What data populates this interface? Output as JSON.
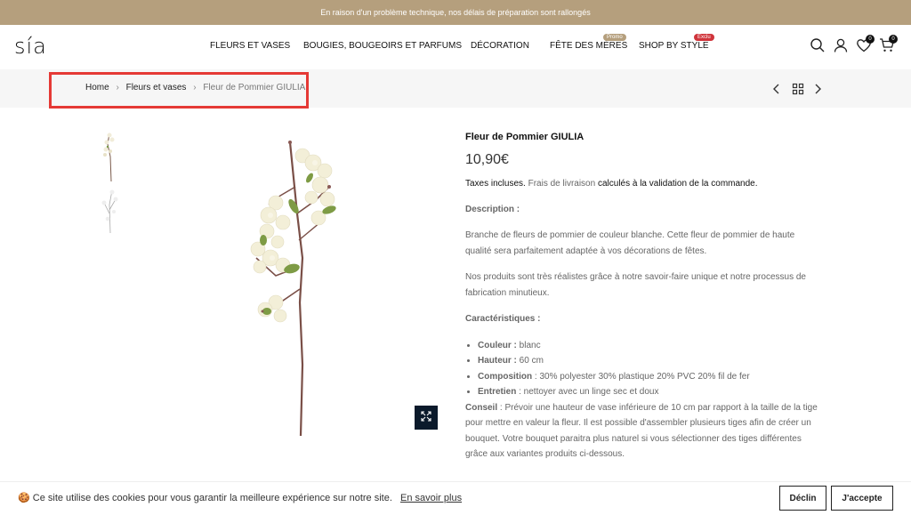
{
  "announcement": "En raison d'un problème technique, nos délais de préparation sont rallongés",
  "header": {
    "logo": "sía",
    "nav": [
      {
        "label": "FLEURS ET VASES"
      },
      {
        "label": "BOUGIES, BOUGEOIRS ET PARFUMS"
      },
      {
        "label": "DÉCORATION"
      },
      {
        "label": "FÊTE DES MÈRES",
        "badge": "Promo",
        "badge_color": "#b59f7d"
      },
      {
        "label": "SHOP BY STYLE",
        "badge": "Exclu",
        "badge_color": "#d0343b"
      }
    ],
    "wishlist_count": "0",
    "cart_count": "0"
  },
  "breadcrumb": {
    "home": "Home",
    "category": "Fleurs et vases",
    "current": "Fleur de Pommier GIULIA",
    "sep": "›"
  },
  "product": {
    "title": "Fleur de Pommier GIULIA",
    "price": "10,90€",
    "tax_prefix": "Taxes incluses.",
    "tax_link": "Frais de livraison",
    "tax_suffix": "calculés à la validation de la commande.",
    "description_heading": "Description :",
    "description_1": "Branche de fleurs de pommier de couleur blanche. Cette fleur de pommier de haute qualité sera parfaitement adaptée à vos décorations de fêtes.",
    "description_2": "Nos produits sont très réalistes grâce à notre savoir-faire unique et notre processus de fabrication minutieux.",
    "specs_heading": "Caractéristiques :",
    "specs": [
      {
        "key": "Couleur :",
        "value": " blanc"
      },
      {
        "key": "Hauteur :",
        "value": " 60 cm"
      },
      {
        "key": "Composition",
        "value": " : 30% polyester 30% plastique 20% PVC 20% fil de fer"
      },
      {
        "key": "Entretien",
        "value": " : nettoyer avec un linge sec et doux"
      }
    ],
    "conseil_key": "Conseil",
    "conseil_text": " : Prévoir une hauteur de vase inférieure de 10 cm par rapport à la taille de la tige pour mettre en valeur la fleur. Il est possible d'assembler plusieurs tiges afin de créer un bouquet. Votre bouquet paraitra plus naturel si vous sélectionner des tiges différentes grâce aux variantes produits ci-dessous."
  },
  "cookie": {
    "icon": "🍪",
    "text": "Ce site utilise des cookies pour vous garantir la meilleure expérience sur notre site.",
    "link": "En savoir plus",
    "decline": "Déclin",
    "accept": "J'accepte"
  },
  "colors": {
    "announcement_bg": "#b59f7d",
    "highlight": "#e53935",
    "zoom_bg": "#0b1a2b"
  }
}
